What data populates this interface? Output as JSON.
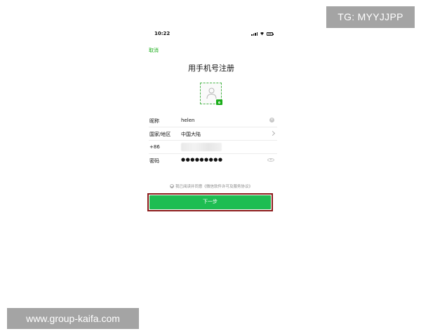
{
  "watermarks": {
    "top": "TG: MYYJJPP",
    "bottom": "www.group-kaifa.com"
  },
  "status_bar": {
    "time": "10:22",
    "icons": [
      "signal-icon",
      "wifi-icon",
      "battery-icon"
    ]
  },
  "nav": {
    "cancel_label": "取消",
    "title": "用手机号注册"
  },
  "avatar": {
    "icons": [
      "person-placeholder-icon",
      "camera-icon"
    ]
  },
  "form": {
    "nickname": {
      "label": "昵称",
      "value": "helen"
    },
    "region": {
      "label": "国家/地区",
      "value": "中国大陆"
    },
    "phone": {
      "label": "+86",
      "value": ""
    },
    "password": {
      "label": "密码",
      "value": "●●●●●●●●●"
    }
  },
  "agreement": {
    "text": "我已阅读并同意《微信软件许可及服务协议》"
  },
  "actions": {
    "next_label": "下一步"
  },
  "colors": {
    "accent": "#1aad19",
    "button": "#1ebd52",
    "highlight_border": "#8b1a1a",
    "watermark_bg": "#a4a4a4"
  }
}
